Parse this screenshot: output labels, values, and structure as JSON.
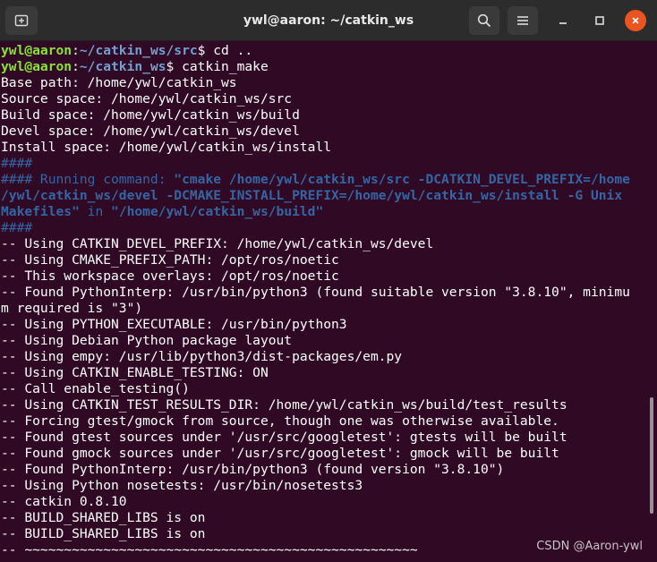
{
  "window": {
    "title": "ywl@aaron: ~/catkin_ws",
    "new_tab_icon": "new-tab-icon",
    "search_icon": "search-icon",
    "menu_icon": "hamburger-menu-icon",
    "minimize_icon": "minimize-icon",
    "maximize_icon": "maximize-icon",
    "close_icon": "close-icon",
    "close_color": "#e95420",
    "background": "#300a24"
  },
  "terminal": {
    "prompt1": {
      "user": "ywl@aaron",
      "sep": ":",
      "path": "~/catkin_ws/src",
      "cmd": "$ cd .."
    },
    "prompt2": {
      "user": "ywl@aaron",
      "sep": ":",
      "path": "~/catkin_ws",
      "cmd": "$ catkin_make"
    },
    "lines_a": [
      "Base path: /home/ywl/catkin_ws",
      "Source space: /home/ywl/catkin_ws/src",
      "Build space: /home/ywl/catkin_ws/build",
      "Devel space: /home/ywl/catkin_ws/devel",
      "Install space: /home/ywl/catkin_ws/install"
    ],
    "hash": "####",
    "running_prefix": "#### Running command: ",
    "running_cmd1": "\"cmake /home/ywl/catkin_ws/src -DCATKIN_DEVEL_PREFIX=/home",
    "running_cmd2": "/ywl/catkin_ws/devel -DCMAKE_INSTALL_PREFIX=/home/ywl/catkin_ws/install -G Unix",
    "running_cmd3a": "Makefiles\"",
    "running_in": " in ",
    "running_cmd3b": "\"/home/ywl/catkin_ws/build\"",
    "hash2": "####",
    "lines_b": [
      "-- Using CATKIN_DEVEL_PREFIX: /home/ywl/catkin_ws/devel",
      "-- Using CMAKE_PREFIX_PATH: /opt/ros/noetic",
      "-- This workspace overlays: /opt/ros/noetic",
      "-- Found PythonInterp: /usr/bin/python3 (found suitable version \"3.8.10\", minimu",
      "m required is \"3\")",
      "-- Using PYTHON_EXECUTABLE: /usr/bin/python3",
      "-- Using Debian Python package layout",
      "-- Using empy: /usr/lib/python3/dist-packages/em.py",
      "-- Using CATKIN_ENABLE_TESTING: ON",
      "-- Call enable_testing()",
      "-- Using CATKIN_TEST_RESULTS_DIR: /home/ywl/catkin_ws/build/test_results",
      "-- Forcing gtest/gmock from source, though one was otherwise available.",
      "-- Found gtest sources under '/usr/src/googletest': gtests will be built",
      "-- Found gmock sources under '/usr/src/googletest': gmock will be built",
      "-- Found PythonInterp: /usr/bin/python3 (found version \"3.8.10\")",
      "-- Using Python nosetests: /usr/bin/nosetests3",
      "-- catkin 0.8.10",
      "-- BUILD_SHARED_LIBS is on",
      "-- BUILD_SHARED_LIBS is on",
      "-- ~~~~~~~~~~~~~~~~~~~~~~~~~~~~~~~~~~~~~~~~~~~~~~~~~~"
    ]
  },
  "watermark": "CSDN @Aaron-ywl"
}
